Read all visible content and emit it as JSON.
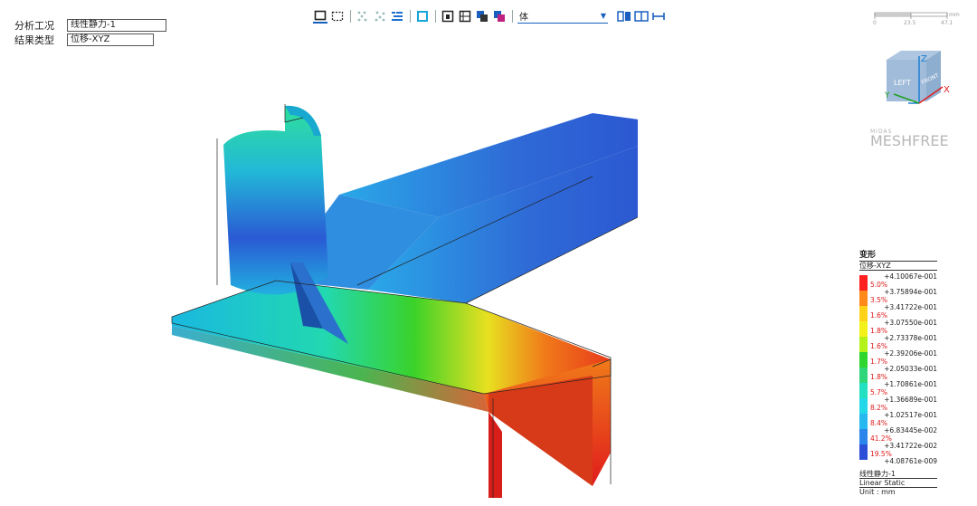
{
  "info": {
    "case_label": "分析工况",
    "case_value": "线性静力-1",
    "result_label": "结果类型",
    "result_value": "位移-XYZ"
  },
  "toolbar": {
    "select_value": "体"
  },
  "scale": {
    "unit": "mm",
    "ticks": [
      "0",
      "23.5",
      "47.1"
    ]
  },
  "cube": {
    "faces": [
      "LEFT",
      "FRONT"
    ],
    "axes": [
      "Z",
      "X",
      "Y"
    ]
  },
  "logo": {
    "small": "MIDAS",
    "big": "MESHFREE"
  },
  "legend": {
    "title": "变形",
    "subtitle": "位移-XYZ",
    "values": [
      "+4.10067e-001",
      "+3.75894e-001",
      "+3.41722e-001",
      "+3.07550e-001",
      "+2.73378e-001",
      "+2.39206e-001",
      "+2.05033e-001",
      "+1.70861e-001",
      "+1.36689e-001",
      "+1.02517e-001",
      "+6.83445e-002",
      "+3.41722e-002",
      "+4.08761e-009"
    ],
    "percents": [
      "5.0%",
      "3.5%",
      "1.6%",
      "1.8%",
      "1.6%",
      "1.7%",
      "1.8%",
      "5.7%",
      "8.2%",
      "8.4%",
      "41.2%",
      "19.5%"
    ],
    "colors": [
      "#ff1f1f",
      "#ff8a1a",
      "#ffd21a",
      "#f2f21a",
      "#b4f21a",
      "#2fd62f",
      "#2fd67a",
      "#22e0c0",
      "#22d8e8",
      "#28b8f0",
      "#2a86ea",
      "#2b4fd6"
    ],
    "footer_case": "线性静力-1",
    "footer_type": "Linear Static",
    "footer_unit": "Unit : mm"
  }
}
